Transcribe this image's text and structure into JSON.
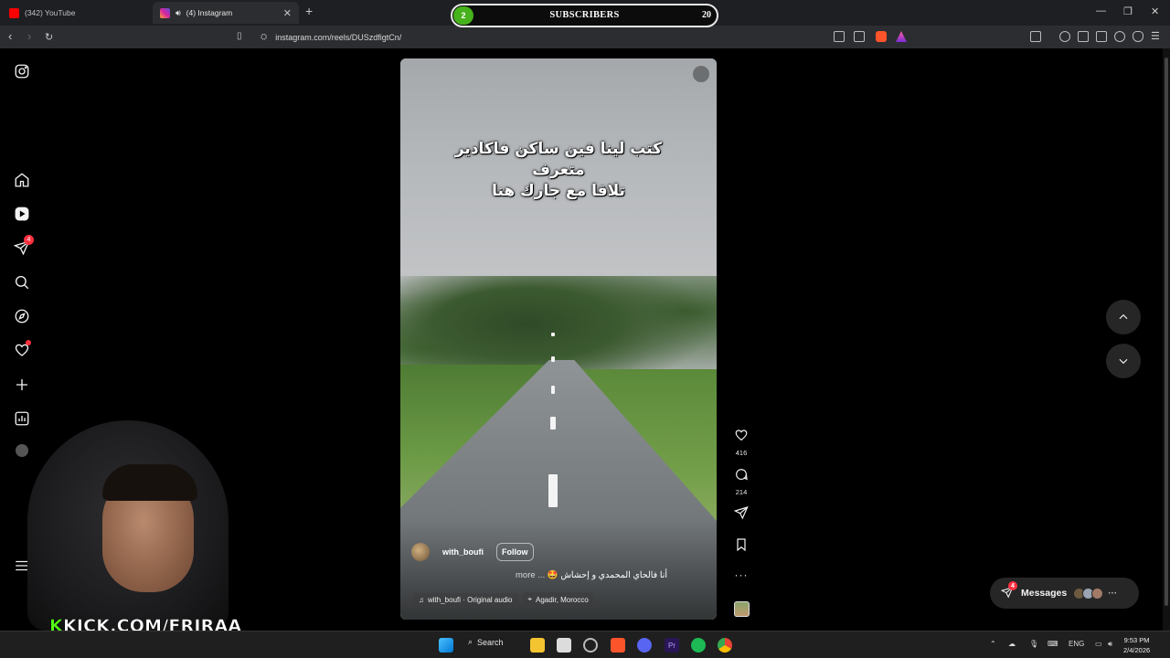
{
  "browser": {
    "tabs": [
      {
        "label": "(342) YouTube",
        "color": "#ff0000"
      },
      {
        "label": "(4) Instagram",
        "color": "#d6249f",
        "active": true
      }
    ],
    "url": "instagram.com/reels/DUSzdfigtCn/",
    "new_tab": "+"
  },
  "subscribers_widget": {
    "badge": "2",
    "label": "SUBSCRIBERS",
    "count": "20"
  },
  "sidebar": {
    "icons": [
      "instagram-logo-icon",
      "home-icon",
      "reels-icon",
      "direct-send-icon",
      "search-icon",
      "explore-icon",
      "heart-icon",
      "create-plus-icon",
      "insights-icon",
      "profile-avatar",
      "menu-icon"
    ],
    "send_badge": "4"
  },
  "reel": {
    "overlay_text_line1": "كتب لينا فين ساكن فاكادير متعرف",
    "overlay_text_line2": "تلاقا مع جارك هنا",
    "username": "with_boufi",
    "follow_label": "Follow",
    "description": "أنا فالحاي المحمدي و إحشاش 🤩",
    "more_label": "... more",
    "audio": "with_boufi · Original audio",
    "location": "Agadir, Morocco"
  },
  "actions": {
    "likes": "416",
    "comments": "214"
  },
  "messages": {
    "label": "Messages",
    "badge": "4"
  },
  "stream": {
    "brand_k": "K",
    "brand_rest": "KICK.COM/FRIRAA"
  },
  "taskbar": {
    "search_label": "Search",
    "language": "ENG",
    "time": "9:53 PM",
    "date": "2/4/2026"
  }
}
